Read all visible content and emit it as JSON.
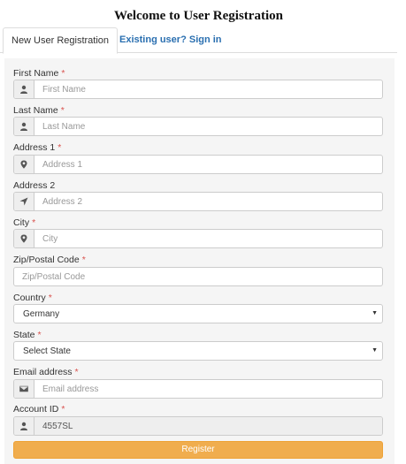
{
  "page": {
    "title": "Welcome to User Registration"
  },
  "tabs": {
    "active": "New User Registration",
    "signin": "Existing user? Sign in"
  },
  "form": {
    "required_marker": "*",
    "first_name": {
      "label": "First Name",
      "placeholder": "First Name",
      "icon": "user-icon"
    },
    "last_name": {
      "label": "Last Name",
      "placeholder": "Last Name",
      "icon": "user-icon"
    },
    "address1": {
      "label": "Address 1",
      "placeholder": "Address 1",
      "icon": "map-marker-icon"
    },
    "address2": {
      "label": "Address 2",
      "placeholder": "Address 2",
      "icon": "location-arrow-icon"
    },
    "city": {
      "label": "City",
      "placeholder": "City",
      "icon": "map-marker-icon"
    },
    "zip": {
      "label": "Zip/Postal Code",
      "placeholder": "Zip/Postal Code"
    },
    "country": {
      "label": "Country",
      "value": "Germany"
    },
    "state": {
      "label": "State",
      "value": "Select State"
    },
    "email": {
      "label": "Email address",
      "placeholder": "Email address",
      "icon": "envelope-icon"
    },
    "account_id": {
      "label": "Account ID",
      "value": "4557SL",
      "icon": "user-icon"
    },
    "register_label": "Register"
  },
  "colors": {
    "accent": "#f0ad4e",
    "link": "#2a6fb0",
    "required": "#d9534f"
  }
}
